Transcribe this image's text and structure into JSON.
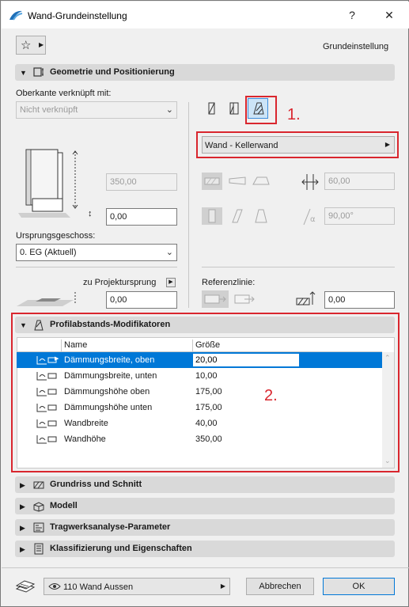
{
  "window": {
    "title": "Wand-Grundeinstellung",
    "help": "?",
    "close": "✕"
  },
  "header": {
    "favorites_label": "☆",
    "preset_label": "Grundeinstellung"
  },
  "sections": {
    "geometry": "Geometrie und Positionierung",
    "profile": "Profilabstands-Modifikatoren",
    "floorplan": "Grundriss und Schnitt",
    "model": "Modell",
    "structural": "Tragwerksanalyse-Parameter",
    "classification": "Klassifizierung und Eigenschaften"
  },
  "geometry": {
    "top_linked_label": "Oberkante verknüpft mit:",
    "top_linked_value": "Nicht verknüpft",
    "height_value": "350,00",
    "bottom_offset_value": "0,00",
    "home_story_label": "Ursprungsgeschoss:",
    "home_story_value": "0. EG (Aktuell)",
    "project_zero_label": "zu Projektursprung",
    "project_zero_value": "0,00",
    "profile_name": "Wand - Kellerwand",
    "thickness_value": "60,00",
    "angle_value": "90,00°",
    "reference_line_label": "Referenzlinie:",
    "reference_offset_value": "0,00"
  },
  "annotations": {
    "one": "1.",
    "two": "2."
  },
  "table": {
    "col_name": "Name",
    "col_size": "Größe",
    "rows": [
      {
        "name": "Dämmungsbreite, oben",
        "value": "20,00"
      },
      {
        "name": "Dämmungsbreite, unten",
        "value": "10,00"
      },
      {
        "name": "Dämmungshöhe oben",
        "value": "175,00"
      },
      {
        "name": "Dämmungshöhe unten",
        "value": "175,00"
      },
      {
        "name": "Wandbreite",
        "value": "40,00"
      },
      {
        "name": "Wandhöhe",
        "value": "350,00"
      }
    ]
  },
  "footer": {
    "layer_value": "110 Wand Aussen",
    "cancel_label": "Abbrechen",
    "ok_label": "OK"
  },
  "colors": {
    "accent": "#0078d7",
    "annotation": "#d9262e"
  }
}
